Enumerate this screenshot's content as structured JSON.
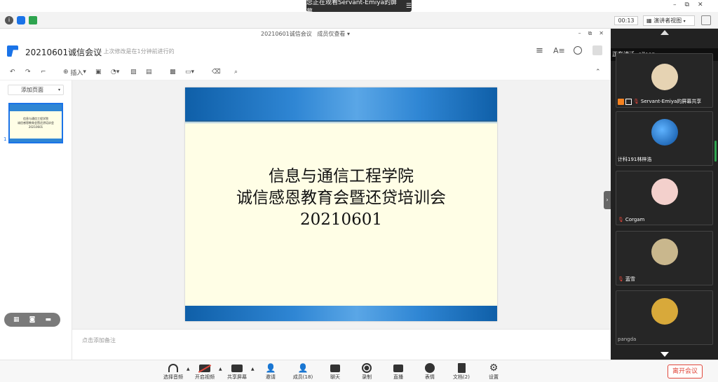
{
  "share_banner": {
    "text": "您正在观看Servant-Emiya的屏幕"
  },
  "topbar": {
    "timer": "00:13",
    "view_mode": "演讲者视图"
  },
  "doc": {
    "window_title": "20210601诚信会议",
    "access": "成员仅查看",
    "title": "20210601诚信会议",
    "save_status": "上次修改是在1分钟前进行的",
    "insert_label": "插入",
    "add_page": "添加页面",
    "thumb_number": "1",
    "notes_placeholder": "点击添加备注"
  },
  "thumb": {
    "line1": "信息与通信工程学院",
    "line2": "诚信感恩教育会暨还贷培训会",
    "line3": "20210601"
  },
  "slide": {
    "line1": "信息与通信工程学院",
    "line2": "诚信感恩教育会暨还贷培训会",
    "line3": "20210601"
  },
  "sidebar": {
    "speaking": "正在讲话: eileen;",
    "participants": [
      {
        "name": "Servant-Emiya的屏幕共享"
      },
      {
        "name": "计科191林梓浩"
      },
      {
        "name": "Corgam"
      },
      {
        "name": "蓝雪"
      },
      {
        "name": "pangda"
      }
    ]
  },
  "bottombar": {
    "audio": "选择音频",
    "video": "开启视频",
    "share": "共享屏幕",
    "invite": "邀请",
    "members": "成员(18)",
    "chat": "聊天",
    "record": "录制",
    "live": "直播",
    "emoji": "表情",
    "docs": "文档(2)",
    "settings": "设置",
    "leave": "离开会议"
  },
  "colors": {
    "accent": "#1a73e8",
    "leave": "#e0463a",
    "slide_blue": "#2f86d4"
  }
}
